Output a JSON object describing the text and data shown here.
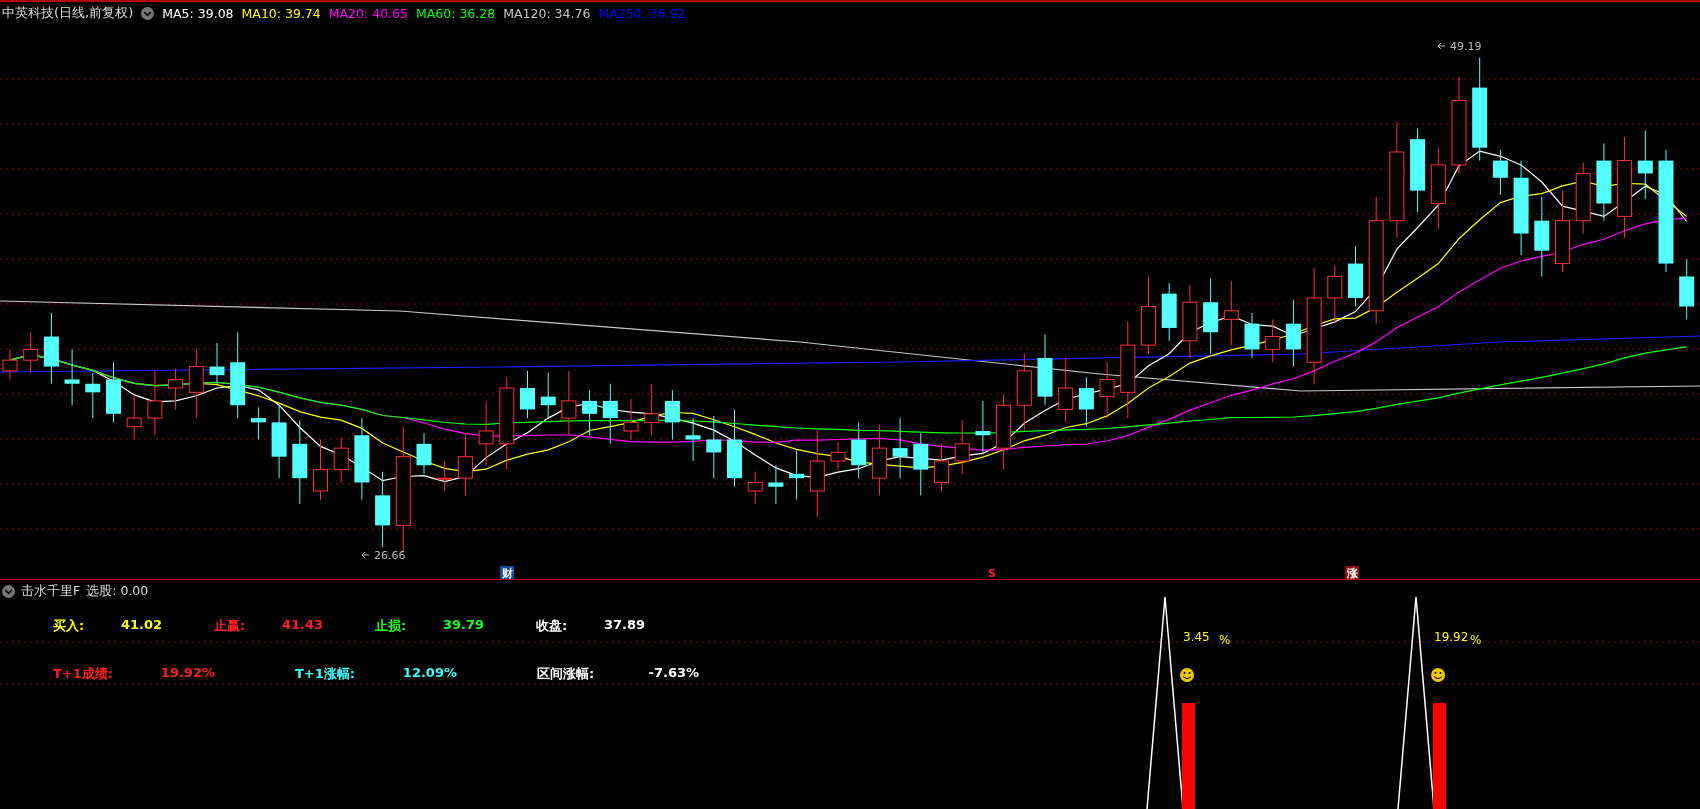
{
  "stock_header": {
    "title": "中英科技(日线,前复权)",
    "moving_averages": [
      {
        "label": "MA5: 39.08",
        "color": "#ffffff"
      },
      {
        "label": "MA10: 39.74",
        "color": "#ffff00"
      },
      {
        "label": "MA20: 40.65",
        "color": "#ff00ff"
      },
      {
        "label": "MA60: 36.28",
        "color": "#00ff00"
      },
      {
        "label": "MA120: 34.76",
        "color": "#c8c8c8"
      },
      {
        "label": "MA250: 36.92",
        "color": "#0000ff"
      }
    ]
  },
  "price_chart": {
    "high_label": "49.19",
    "low_label": "26.66",
    "event_markers": [
      {
        "text": "财",
        "kind": "finance"
      },
      {
        "text": "S",
        "kind": "signal"
      },
      {
        "text": "涨",
        "kind": "limit-up"
      }
    ]
  },
  "indicator": {
    "title": "击水千里F",
    "value_label": "选股: 0.00",
    "stat_rows": [
      [
        {
          "label": "买入:",
          "value": "41.02",
          "color": "#ffff00"
        },
        {
          "label": "止赢:",
          "value": "41.43",
          "color": "#ff2020"
        },
        {
          "label": "止损:",
          "value": "39.79",
          "color": "#20ff20"
        },
        {
          "label": "收盘:",
          "value": "37.89",
          "color": "#ffffff"
        }
      ],
      [
        {
          "label": "T+1成绩:",
          "value": "19.92%",
          "color": "#ff2020"
        },
        {
          "label": "T+1涨幅:",
          "value": "12.09%",
          "color": "#40ffff"
        },
        {
          "label": "区间涨幅:",
          "value": "-7.63%",
          "color": "#ffffff"
        }
      ]
    ],
    "signals": [
      {
        "percent": "3.45",
        "unit": "%"
      },
      {
        "percent": "19.92",
        "unit": "%"
      }
    ]
  }
}
